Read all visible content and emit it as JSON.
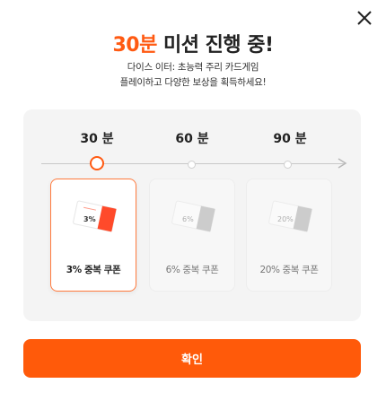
{
  "header": {
    "title_accent": "30분",
    "title_rest": " 미션 진행 중!",
    "subtitle_line1": "다이스 이터: 초능력 주리 카드게임",
    "subtitle_line2": "플레이하고 다양한 보상을 획득하세요!",
    "close_icon": "close-icon"
  },
  "timeline": {
    "labels": [
      "30 분",
      "60 분",
      "90 분"
    ],
    "active_index": 0,
    "accent_color": "#ff5a12"
  },
  "rewards": [
    {
      "label": "3% 중복 쿠폰",
      "badge": "3%",
      "selected": true
    },
    {
      "label": "6% 중복 쿠폰",
      "badge": "6%",
      "selected": false
    },
    {
      "label": "20% 중복 쿠폰",
      "badge": "20%",
      "selected": false
    }
  ],
  "confirm": {
    "label": "확인",
    "color": "#ff5a0a"
  }
}
